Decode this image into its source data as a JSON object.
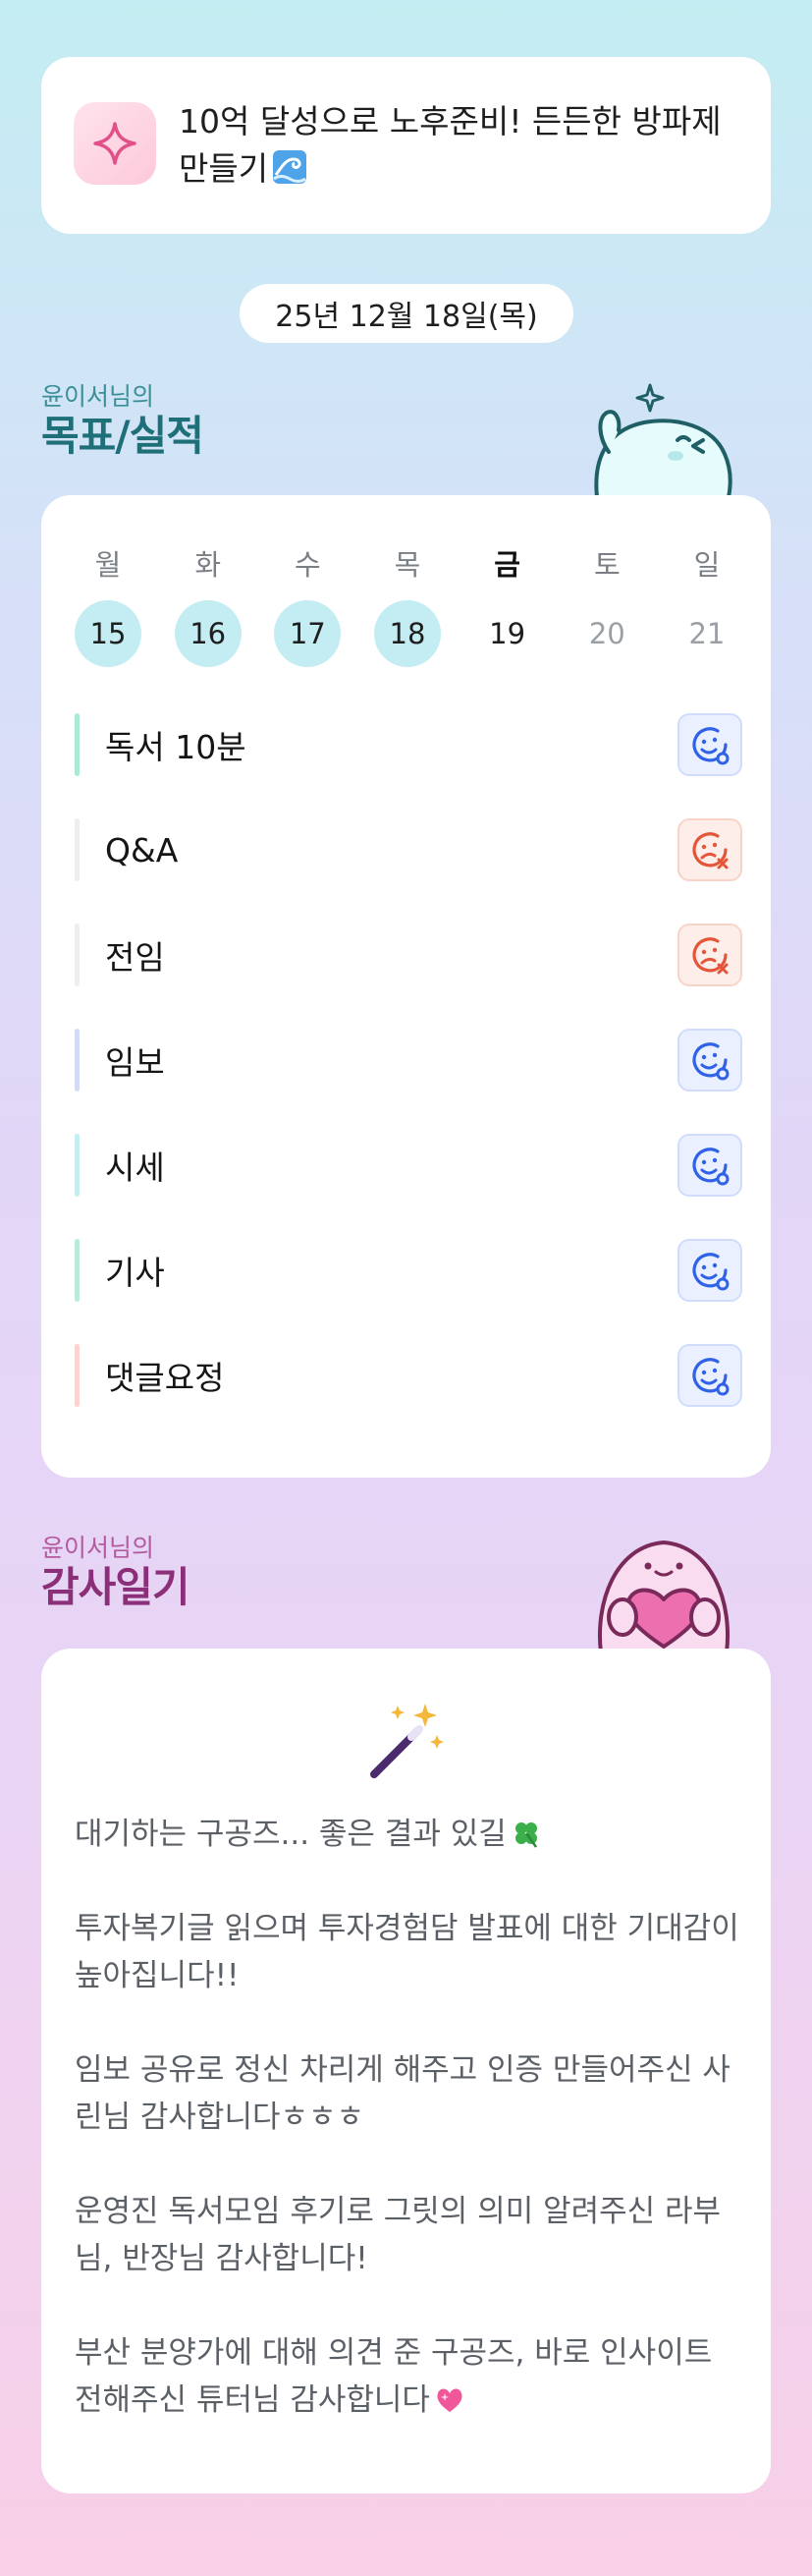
{
  "goal": {
    "text": "10억 달성으로 노후준비! 든든한 방파제 만들기",
    "icon": "sparkle-icon",
    "trailing_icon": "wave-icon"
  },
  "date": "25년 12월 18일(목)",
  "goals_section": {
    "subtitle": "윤이서님의",
    "title": "목표/실적"
  },
  "week": {
    "days": [
      {
        "name": "월",
        "num": "15",
        "state": "done"
      },
      {
        "name": "화",
        "num": "16",
        "state": "done"
      },
      {
        "name": "수",
        "num": "17",
        "state": "done"
      },
      {
        "name": "목",
        "num": "18",
        "state": "done"
      },
      {
        "name": "금",
        "num": "19",
        "state": "today"
      },
      {
        "name": "토",
        "num": "20",
        "state": "future"
      },
      {
        "name": "일",
        "num": "21",
        "state": "future"
      }
    ]
  },
  "tasks": [
    {
      "label": "독서 10분",
      "status": "success",
      "bar_color": "#a8ead6"
    },
    {
      "label": "Q&A",
      "status": "fail",
      "bar_color": "#eeeeee"
    },
    {
      "label": "전임",
      "status": "fail",
      "bar_color": "#eeeeee"
    },
    {
      "label": "임보",
      "status": "success",
      "bar_color": "#d4dbf7"
    },
    {
      "label": "시세",
      "status": "success",
      "bar_color": "#c4eef2"
    },
    {
      "label": "기사",
      "status": "success",
      "bar_color": "#b9ecd8"
    },
    {
      "label": "댓글요정",
      "status": "success",
      "bar_color": "#fcd3cf"
    }
  ],
  "gratitude_section": {
    "subtitle": "윤이서님의",
    "title": "감사일기"
  },
  "gratitude": {
    "entries": [
      "대기하는 구공즈... 좋은 결과 있길",
      "투자복기글 읽으며 투자경험담 발표에 대한 기대감이 높아집니다!!",
      "임보 공유로 정신 차리게 해주고 인증 만들어주신 사린님 감사합니다ㅎㅎㅎ",
      "운영진 독서모임 후기로 그릿의 의미 알려주신 라부님, 반장님 감사합니다!",
      "부산 분양가에 대해 의견 준 구공즈, 바로 인사이트 전해주신 튜터님 감사합니다"
    ]
  },
  "colors": {
    "accent_teal": "#1f6f78",
    "accent_plum": "#8a2f78",
    "done_circle": "#c3edf2",
    "success_blue": "#2f62e6",
    "fail_red": "#e4563a"
  }
}
